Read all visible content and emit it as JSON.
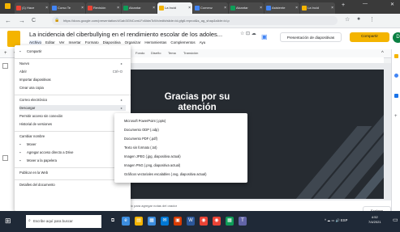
{
  "browser": {
    "tabs": [
      {
        "label": "(1) Hace",
        "color": "#ea4335"
      },
      {
        "label": "Curso Te",
        "color": "#4285f4"
      },
      {
        "label": "Revisión",
        "color": "#ea4335"
      },
      {
        "label": "Alcantar",
        "color": "#0f9d58"
      },
      {
        "label": "La Incid",
        "color": "#f4b400"
      },
      {
        "label": "Comenz",
        "color": "#4285f4"
      },
      {
        "label": "Alcantar",
        "color": "#0f9d58"
      },
      {
        "label": "Asistente",
        "color": "#4285f4"
      },
      {
        "label": "La Incid",
        "color": "#f4b400"
      }
    ],
    "active_tab": 4,
    "url": "https://docs.google.com/presentation/d/1ab3GNCcmLFc6IdwTcWc/edit#slide=id.gfg6.reprod&s_ag_shap&slide=id.p",
    "new_tab_label": "+",
    "nav_back": "←",
    "nav_forward": "→",
    "nav_reload": "C"
  },
  "docs": {
    "title": "La incidencia del ciberbullying en el rendimiento escolar de los adoles...",
    "menus": [
      "Archivo",
      "Editar",
      "Ver",
      "Insertar",
      "Formato",
      "Diapositiva",
      "Organizar",
      "Herramientas",
      "Complementos",
      "Ayu"
    ],
    "open_menu": "Archivo",
    "present_label": "Presentación de diapositivas",
    "share_label": "Compartir",
    "avatar_letter": "D",
    "toolbar_labels": [
      "Fondo",
      "Diseño",
      "Tema",
      "Transición"
    ]
  },
  "file_menu": {
    "items": [
      {
        "label": "Compartir",
        "icon": "share-icon",
        "shortcut": "",
        "submenu": false,
        "gap_after": true
      },
      {
        "label": "Nuevo",
        "icon": "",
        "shortcut": "",
        "submenu": true,
        "gap_after": false
      },
      {
        "label": "Abrir",
        "icon": "",
        "shortcut": "Ctrl+O",
        "submenu": false,
        "gap_after": false
      },
      {
        "label": "Importar diapositivas",
        "icon": "",
        "shortcut": "",
        "submenu": false,
        "gap_after": false
      },
      {
        "label": "Crear una copia",
        "icon": "",
        "shortcut": "",
        "submenu": false,
        "gap_after": true
      },
      {
        "label": "Correo electrónico",
        "icon": "",
        "shortcut": "",
        "submenu": true,
        "gap_after": false
      },
      {
        "label": "Descargar",
        "icon": "",
        "shortcut": "",
        "submenu": true,
        "gap_after": false,
        "highlighted": true
      },
      {
        "label": "Permitir acceso sin conexión",
        "icon": "",
        "shortcut": "",
        "submenu": false,
        "gap_after": false
      },
      {
        "label": "Historial de versiones",
        "icon": "",
        "shortcut": "",
        "submenu": true,
        "gap_after": true
      },
      {
        "label": "Cambiar nombre",
        "icon": "",
        "shortcut": "",
        "submenu": false,
        "gap_after": false
      },
      {
        "label": "Mover",
        "icon": "folder-icon",
        "shortcut": "",
        "submenu": false,
        "gap_after": false
      },
      {
        "label": "Agregar acceso directo a Drive",
        "icon": "drive-shortcut-icon",
        "shortcut": "",
        "submenu": false,
        "gap_after": false
      },
      {
        "label": "Mover a la papelera",
        "icon": "trash-icon",
        "shortcut": "",
        "submenu": false,
        "gap_after": true
      },
      {
        "label": "Publicar en la Web",
        "icon": "",
        "shortcut": "",
        "submenu": false,
        "gap_after": true
      },
      {
        "label": "Detalles del documento",
        "icon": "",
        "shortcut": "",
        "submenu": false,
        "gap_after": false
      }
    ]
  },
  "download_submenu": {
    "items": [
      "Microsoft PowerPoint (.pptx)",
      "Documento ODP (.odp)",
      "Documento PDF (.pdf)",
      "Texto sin formato (.txt)",
      "Imagen JPEG (.jpg, diapositiva actual)",
      "Imagen PNG (.png, diapositiva actual)",
      "Gráficos vectoriales escalables (.svg, diapositiva actual)"
    ]
  },
  "slide": {
    "title": "Gracias por su atención",
    "background": "#262b31"
  },
  "notes": {
    "placeholder": "Haz clic para agregar notas del orador"
  },
  "explore": {
    "label": "Explorar"
  },
  "taskbar": {
    "search_placeholder": "Escribe aquí para buscar",
    "time": "4:52",
    "date": "7/4/2021",
    "tray": "ESP"
  }
}
